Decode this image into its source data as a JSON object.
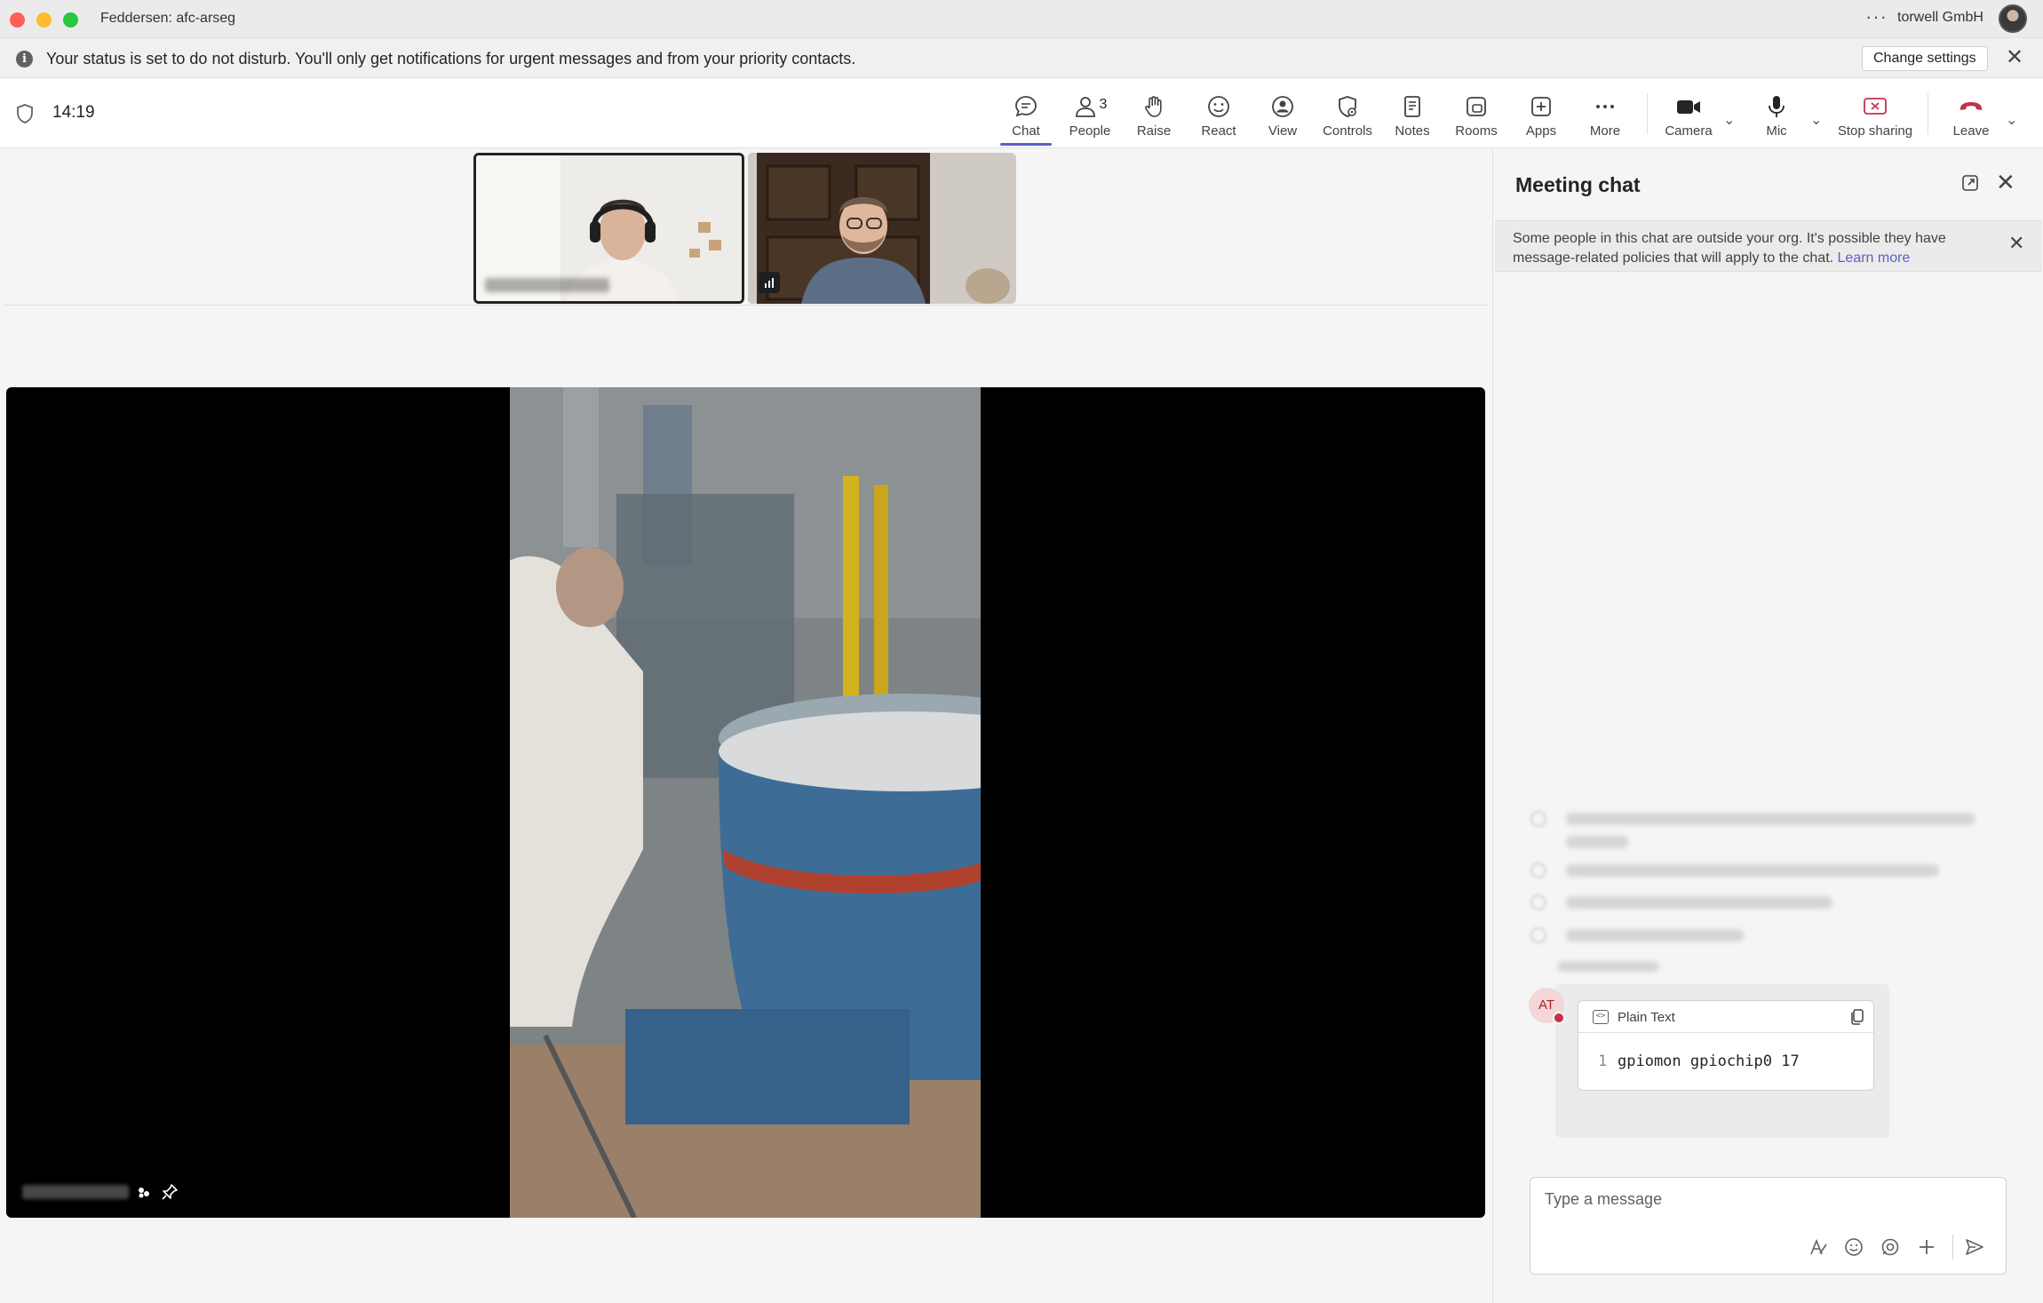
{
  "window": {
    "title": "Feddersen: afc-arseg",
    "org": "torwell GmbH",
    "more": "···"
  },
  "banner": {
    "text": "Your status is set to do not disturb. You'll only get notifications for urgent messages and from your priority contacts.",
    "button": "Change settings",
    "close": "✕"
  },
  "meeting": {
    "elapsed": "14:19"
  },
  "toolbar": {
    "chat": "Chat",
    "people": "People",
    "people_count": "3",
    "raise": "Raise",
    "react": "React",
    "view": "View",
    "controls": "Controls",
    "notes": "Notes",
    "rooms": "Rooms",
    "apps": "Apps",
    "more": "More",
    "camera": "Camera",
    "mic": "Mic",
    "stop_sharing": "Stop sharing",
    "leave": "Leave",
    "chevron": "⌄"
  },
  "chat": {
    "title": "Meeting chat",
    "close": "✕",
    "notice": "Some people in this chat are outside your org. It's possible they have message-related policies that will apply to the chat.",
    "notice_link": "Learn more",
    "notice_close": "✕",
    "sender_initials": "AT",
    "code_label": "Plain Text",
    "code_line_number": "1",
    "code_text": "gpiomon gpiochip0 17",
    "composer_placeholder": "Type a message"
  },
  "colors": {
    "accent": "#5b5fc7",
    "leave": "#c4314b",
    "stop_sharing": "#c4314b"
  }
}
